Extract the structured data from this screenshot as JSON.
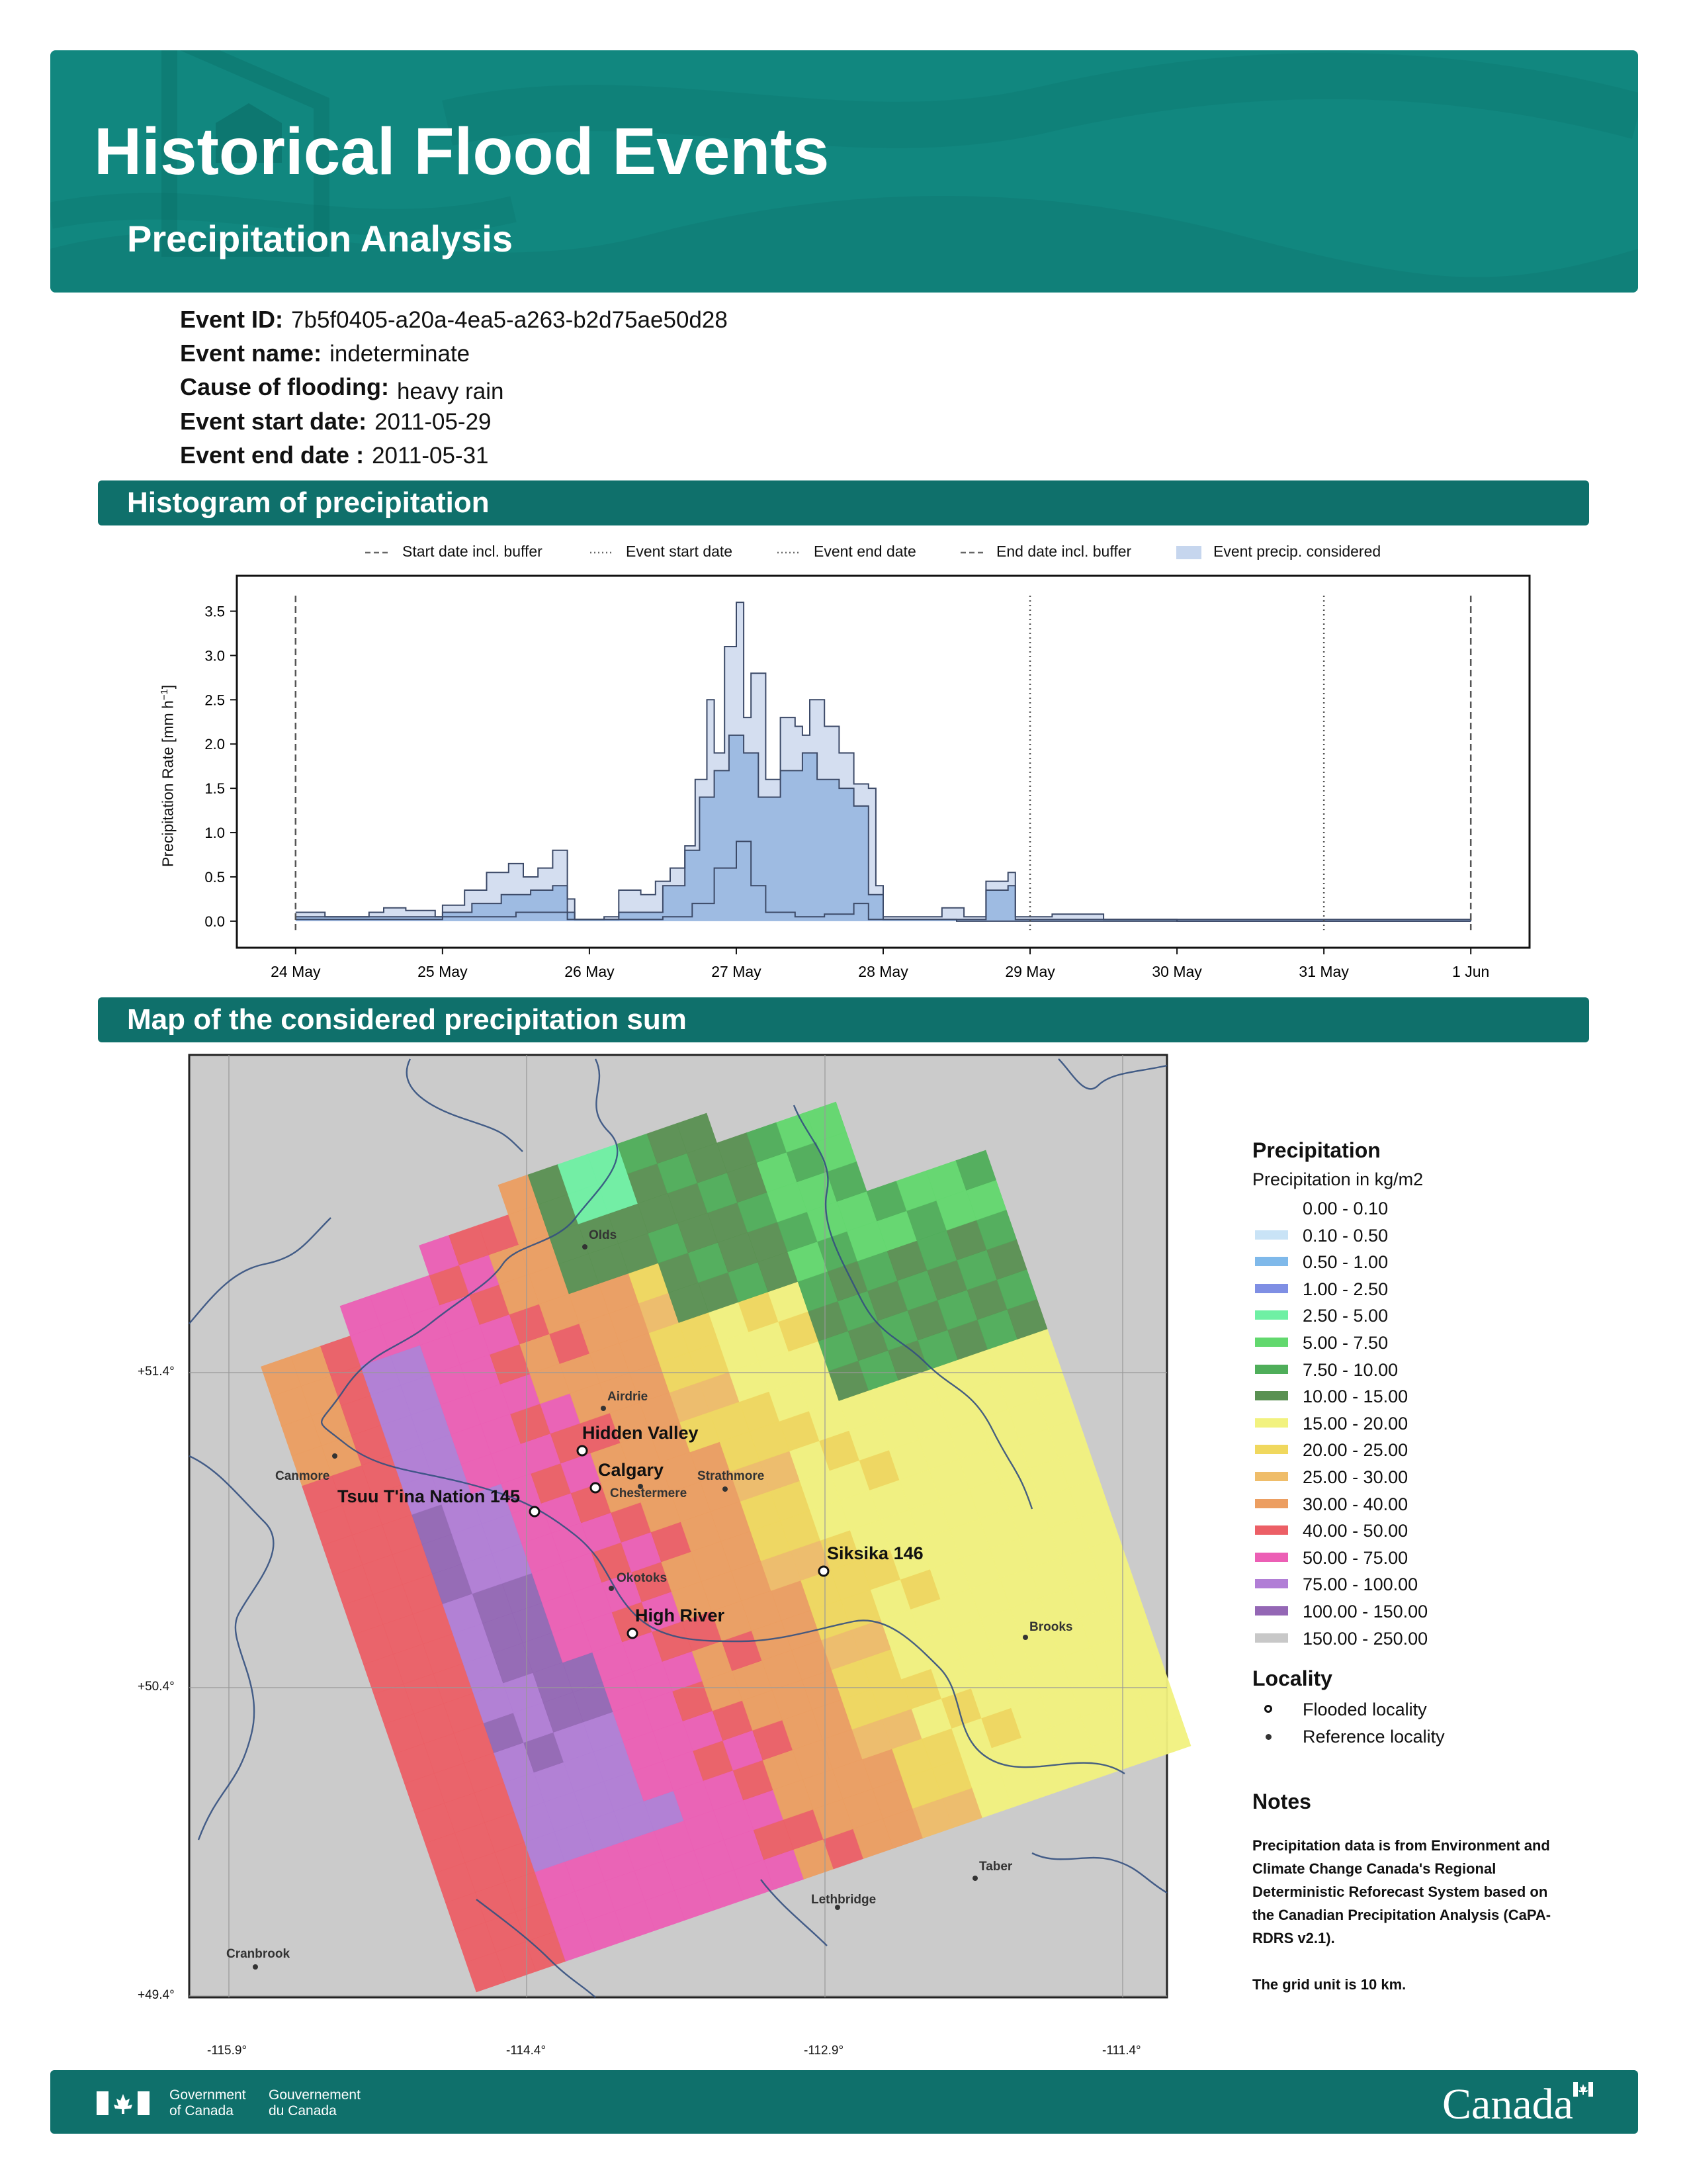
{
  "header": {
    "title": "Historical Flood Events",
    "subtitle": "Precipitation Analysis"
  },
  "event": {
    "id_label": "Event ID:",
    "id_value": "7b5f0405-a20a-4ea5-a263-b2d75ae50d28",
    "name_label": "Event name:",
    "name_value": "indeterminate",
    "cause_label": "Cause of flooding:",
    "cause_value": "heavy rain",
    "start_label": "Event start date:",
    "start_value": "2011-05-29",
    "end_label": "Event end date :",
    "end_value": "2011-05-31"
  },
  "sections": {
    "histogram": "Histogram of precipitation",
    "map": "Map of the considered precipitation sum"
  },
  "chart_data": {
    "type": "area",
    "ylabel": "Precipitation Rate [mm h⁻¹]",
    "ylabel_main": "Precipitation Rate [mm h",
    "ylabel_sup": "−1",
    "ylabel_end": "]",
    "ylim": [
      -0.3,
      3.9
    ],
    "yticks": [
      0.0,
      0.5,
      1.0,
      1.5,
      2.0,
      2.5,
      3.0,
      3.5
    ],
    "ytick_labels": [
      "0.0",
      "0.5",
      "1.0",
      "1.5",
      "2.0",
      "2.5",
      "3.0",
      "3.5"
    ],
    "xlim_days": [
      23.6,
      32.4
    ],
    "xticks": [
      24,
      25,
      26,
      27,
      28,
      29,
      30,
      31,
      32
    ],
    "xtick_labels": [
      "24 May",
      "25 May",
      "26 May",
      "27 May",
      "28 May",
      "29 May",
      "30 May",
      "31 May",
      "1 Jun"
    ],
    "legend": [
      {
        "label": "Start date incl. buffer",
        "style": "dashed"
      },
      {
        "label": "Event start date",
        "style": "dotted"
      },
      {
        "label": "Event end date",
        "style": "dotted"
      },
      {
        "label": "End date incl. buffer",
        "style": "dashed"
      },
      {
        "label": "Event precip. considered",
        "style": "patch"
      }
    ],
    "vlines": [
      {
        "x": 24.0,
        "style": "dashed"
      },
      {
        "x": 29.0,
        "style": "dotted"
      },
      {
        "x": 31.0,
        "style": "dotted"
      },
      {
        "x": 32.0,
        "style": "dashed"
      }
    ],
    "max_envelope": [
      [
        24.0,
        0.1
      ],
      [
        24.2,
        0.05
      ],
      [
        24.5,
        0.1
      ],
      [
        24.6,
        0.15
      ],
      [
        24.75,
        0.12
      ],
      [
        24.95,
        0.05
      ],
      [
        25.0,
        0.18
      ],
      [
        25.15,
        0.35
      ],
      [
        25.3,
        0.55
      ],
      [
        25.45,
        0.65
      ],
      [
        25.55,
        0.5
      ],
      [
        25.65,
        0.6
      ],
      [
        25.75,
        0.8
      ],
      [
        25.85,
        0.25
      ],
      [
        25.9,
        0.02
      ],
      [
        26.1,
        0.05
      ],
      [
        26.2,
        0.35
      ],
      [
        26.35,
        0.3
      ],
      [
        26.45,
        0.45
      ],
      [
        26.55,
        0.6
      ],
      [
        26.65,
        0.85
      ],
      [
        26.72,
        1.6
      ],
      [
        26.8,
        2.5
      ],
      [
        26.85,
        1.9
      ],
      [
        26.92,
        3.1
      ],
      [
        27.0,
        3.6
      ],
      [
        27.05,
        2.3
      ],
      [
        27.1,
        2.8
      ],
      [
        27.2,
        1.6
      ],
      [
        27.3,
        2.3
      ],
      [
        27.4,
        2.2
      ],
      [
        27.45,
        2.1
      ],
      [
        27.5,
        2.5
      ],
      [
        27.6,
        2.2
      ],
      [
        27.7,
        1.9
      ],
      [
        27.8,
        1.55
      ],
      [
        27.9,
        1.5
      ],
      [
        27.95,
        0.4
      ],
      [
        28.0,
        0.05
      ],
      [
        28.1,
        0.05
      ],
      [
        28.4,
        0.15
      ],
      [
        28.55,
        0.05
      ],
      [
        28.7,
        0.45
      ],
      [
        28.85,
        0.55
      ],
      [
        28.9,
        0.05
      ],
      [
        29.0,
        0.05
      ],
      [
        29.15,
        0.08
      ],
      [
        29.5,
        0.02
      ],
      [
        30.0,
        0.0
      ],
      [
        32.0,
        0.0
      ]
    ],
    "event_median": [
      [
        24.0,
        0.05
      ],
      [
        24.5,
        0.05
      ],
      [
        24.9,
        0.05
      ],
      [
        25.0,
        0.1
      ],
      [
        25.2,
        0.2
      ],
      [
        25.4,
        0.3
      ],
      [
        25.6,
        0.35
      ],
      [
        25.75,
        0.4
      ],
      [
        25.85,
        0.1
      ],
      [
        25.9,
        0.02
      ],
      [
        26.2,
        0.1
      ],
      [
        26.5,
        0.4
      ],
      [
        26.65,
        0.8
      ],
      [
        26.75,
        1.4
      ],
      [
        26.85,
        1.7
      ],
      [
        26.95,
        2.1
      ],
      [
        27.05,
        1.9
      ],
      [
        27.15,
        1.4
      ],
      [
        27.3,
        1.7
      ],
      [
        27.45,
        1.9
      ],
      [
        27.55,
        1.6
      ],
      [
        27.7,
        1.5
      ],
      [
        27.8,
        1.3
      ],
      [
        27.9,
        0.3
      ],
      [
        28.0,
        0.02
      ],
      [
        28.7,
        0.35
      ],
      [
        28.85,
        0.4
      ],
      [
        28.9,
        0.02
      ],
      [
        29.0,
        0.02
      ],
      [
        32.0,
        0.0
      ]
    ],
    "min_envelope": [
      [
        24.0,
        0.02
      ],
      [
        25.0,
        0.05
      ],
      [
        25.5,
        0.1
      ],
      [
        25.85,
        0.02
      ],
      [
        26.5,
        0.05
      ],
      [
        26.7,
        0.2
      ],
      [
        26.85,
        0.6
      ],
      [
        27.0,
        0.9
      ],
      [
        27.1,
        0.4
      ],
      [
        27.2,
        0.1
      ],
      [
        27.4,
        0.05
      ],
      [
        27.6,
        0.08
      ],
      [
        27.8,
        0.2
      ],
      [
        27.9,
        0.02
      ],
      [
        28.5,
        0.0
      ],
      [
        32.0,
        0.0
      ]
    ]
  },
  "map": {
    "lon_labels": [
      "-115.9°",
      "-114.4°",
      "-112.9°",
      "-111.4°"
    ],
    "lat_labels": [
      "+51.4°",
      "+50.4°",
      "+49.4°"
    ],
    "flooded": [
      {
        "name": "Hidden Valley"
      },
      {
        "name": "Calgary"
      },
      {
        "name": "Tsuu T'ina Nation 145"
      },
      {
        "name": "Siksika 146"
      },
      {
        "name": "High River"
      }
    ],
    "reference": [
      {
        "name": "Olds"
      },
      {
        "name": "Airdrie"
      },
      {
        "name": "Canmore"
      },
      {
        "name": "Chestermere"
      },
      {
        "name": "Strathmore"
      },
      {
        "name": "Okotoks"
      },
      {
        "name": "Brooks"
      },
      {
        "name": "Taber"
      },
      {
        "name": "Lethbridge"
      },
      {
        "name": "Cranbrook"
      }
    ]
  },
  "legend_panel": {
    "title": "Precipitation",
    "subtitle": "Precipitation in kg/m2",
    "bins": [
      {
        "label": "0.00 - 0.10",
        "color": "#ffffff"
      },
      {
        "label": "0.10 - 0.50",
        "color": "#c9e3f6"
      },
      {
        "label": "0.50 - 1.00",
        "color": "#7fb9ea"
      },
      {
        "label": "1.00 - 2.50",
        "color": "#7f8fe4"
      },
      {
        "label": "2.50 - 5.00",
        "color": "#6ff0a4"
      },
      {
        "label": "5.00 - 7.50",
        "color": "#62d86e"
      },
      {
        "label": "7.50 - 10.00",
        "color": "#4fae5a"
      },
      {
        "label": "10.00 - 15.00",
        "color": "#5a9152"
      },
      {
        "label": "15.00 - 20.00",
        "color": "#f2f27f"
      },
      {
        "label": "20.00 - 25.00",
        "color": "#f0d85e"
      },
      {
        "label": "25.00 - 30.00",
        "color": "#efbd6a"
      },
      {
        "label": "30.00 - 40.00",
        "color": "#ec9e61"
      },
      {
        "label": "40.00 - 50.00",
        "color": "#ec5f66"
      },
      {
        "label": "50.00 - 75.00",
        "color": "#ec5fb5"
      },
      {
        "label": "75.00 - 100.00",
        "color": "#b17ed6"
      },
      {
        "label": "100.00 - 150.00",
        "color": "#9467b5"
      },
      {
        "label": "150.00 - 250.00",
        "color": "#c8c8c8"
      }
    ],
    "locality_title": "Locality",
    "locality_flooded": "Flooded locality",
    "locality_reference": "Reference locality",
    "notes_title": "Notes",
    "notes_lines": [
      "Precipitation data is from Environment and",
      "Climate Change Canada's Regional",
      "Deterministic Reforecast System based on",
      "the Canadian Precipitation Analysis (CaPA-",
      "RDRS v2.1).",
      "",
      "The grid unit is 10 km."
    ]
  },
  "footer": {
    "gov_en_1": "Government",
    "gov_en_2": "of Canada",
    "gov_fr_1": "Gouvernement",
    "gov_fr_2": "du Canada",
    "wordmark": "Canada"
  }
}
